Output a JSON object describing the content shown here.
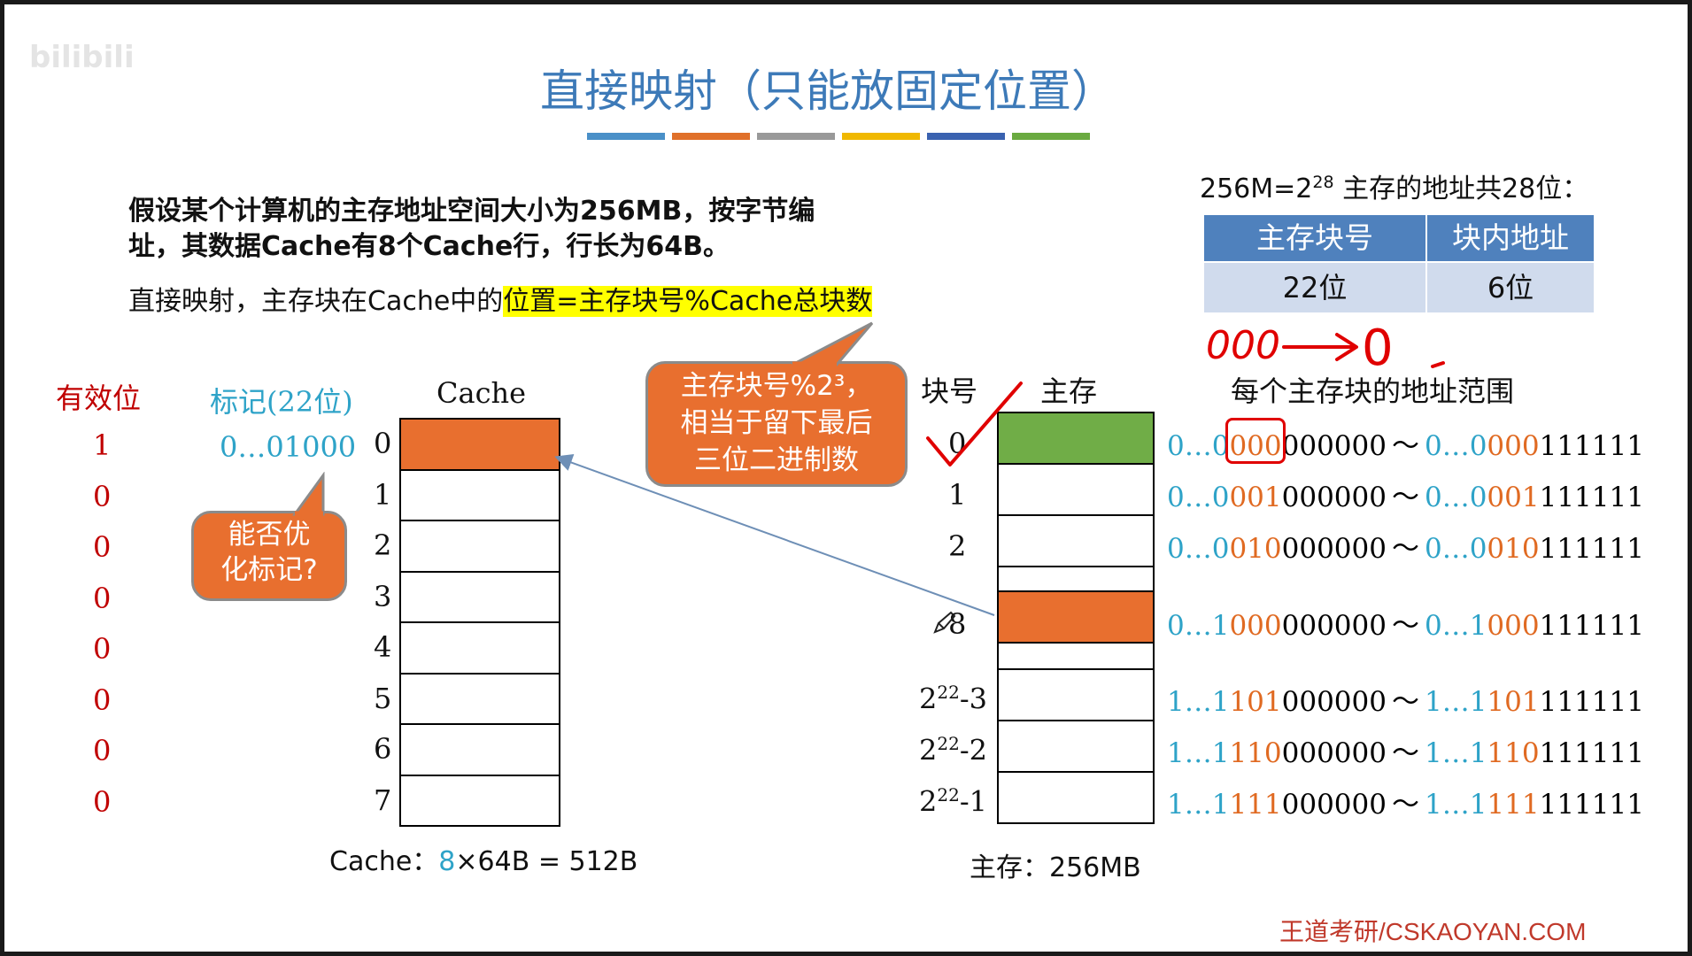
{
  "watermark": "王道考研/CSKAOYAN.COM",
  "title": "直接映射（只能放固定位置）",
  "title_bar_colors": [
    "#4a90c8",
    "#e0702a",
    "#999999",
    "#f0b800",
    "#3a62b0",
    "#6aaa40"
  ],
  "intro": {
    "line1": "假设某个计算机的主存地址空间大小为256MB，按字节编",
    "line2": "址，其数据Cache有8个Cache行，行长为64B。",
    "line3_prefix": "直接映射，主存块在Cache中的",
    "line3_highlight": "位置=主存块号%Cache总块数"
  },
  "callout_mod": {
    "line1": "主存块号%2³，",
    "line2": "相当于留下最后",
    "line3": "三位二进制数"
  },
  "callout_tag": {
    "line1": "能否优",
    "line2": "化标记?"
  },
  "addr_info": {
    "text_prefix": "256M=2",
    "text_exp": "28",
    "text_suffix": " 主存的地址共28位：",
    "col1_header": "主存块号",
    "col2_header": "块内地址",
    "col1_value": "22位",
    "col2_value": "6位"
  },
  "handwriting": {
    "left": "000",
    "right": "0"
  },
  "cache": {
    "header_valid": "有效位",
    "header_tag": "标记(22位)",
    "header_cache": "Cache",
    "valid_bits": [
      "1",
      "0",
      "0",
      "0",
      "0",
      "0",
      "0",
      "0"
    ],
    "tag_row0": "0…01000",
    "row_numbers": [
      "0",
      "1",
      "2",
      "3",
      "4",
      "5",
      "6",
      "7"
    ],
    "caption_prefix": "Cache：",
    "caption_num": "8",
    "caption_suffix": "×64B = 512B"
  },
  "memory": {
    "header_block": "块号",
    "header_mem": "主存",
    "header_range": "每个主存块的地址范围",
    "labels": [
      "0",
      "1",
      "2",
      "8"
    ],
    "exp_labels": [
      {
        "base": "2",
        "exp": "22",
        "tail": "-3"
      },
      {
        "base": "2",
        "exp": "22",
        "tail": "-2"
      },
      {
        "base": "2",
        "exp": "22",
        "tail": "-1"
      }
    ],
    "caption": "主存：256MB",
    "ranges": [
      {
        "a_pre": "0…0",
        "a_mid": "000",
        "a_suf": "000000",
        "sep": "～",
        "b_pre": "0…0",
        "b_mid": "000",
        "b_suf": "111111"
      },
      {
        "a_pre": "0…0",
        "a_mid": "001",
        "a_suf": "000000",
        "sep": "～",
        "b_pre": "0…0",
        "b_mid": "001",
        "b_suf": "111111"
      },
      {
        "a_pre": "0…0",
        "a_mid": "010",
        "a_suf": "000000",
        "sep": "～",
        "b_pre": "0…0",
        "b_mid": "010",
        "b_suf": "111111"
      },
      {
        "a_pre": "0…1",
        "a_mid": "000",
        "a_suf": "000000",
        "sep": "～",
        "b_pre": "0…1",
        "b_mid": "000",
        "b_suf": "111111"
      },
      {
        "a_pre": "1…1",
        "a_mid": "101",
        "a_suf": "000000",
        "sep": "～",
        "b_pre": "1…1",
        "b_mid": "101",
        "b_suf": "111111"
      },
      {
        "a_pre": "1…1",
        "a_mid": "110",
        "a_suf": "000000",
        "sep": "～",
        "b_pre": "1…1",
        "b_mid": "110",
        "b_suf": "111111"
      },
      {
        "a_pre": "1…1",
        "a_mid": "111",
        "a_suf": "000000",
        "sep": "～",
        "b_pre": "1…1",
        "b_mid": "111",
        "b_suf": "111111"
      }
    ]
  },
  "colors": {
    "green_block": "#70ad47",
    "orange_block": "#e86f2f",
    "title_blue": "#3d7ab8"
  }
}
